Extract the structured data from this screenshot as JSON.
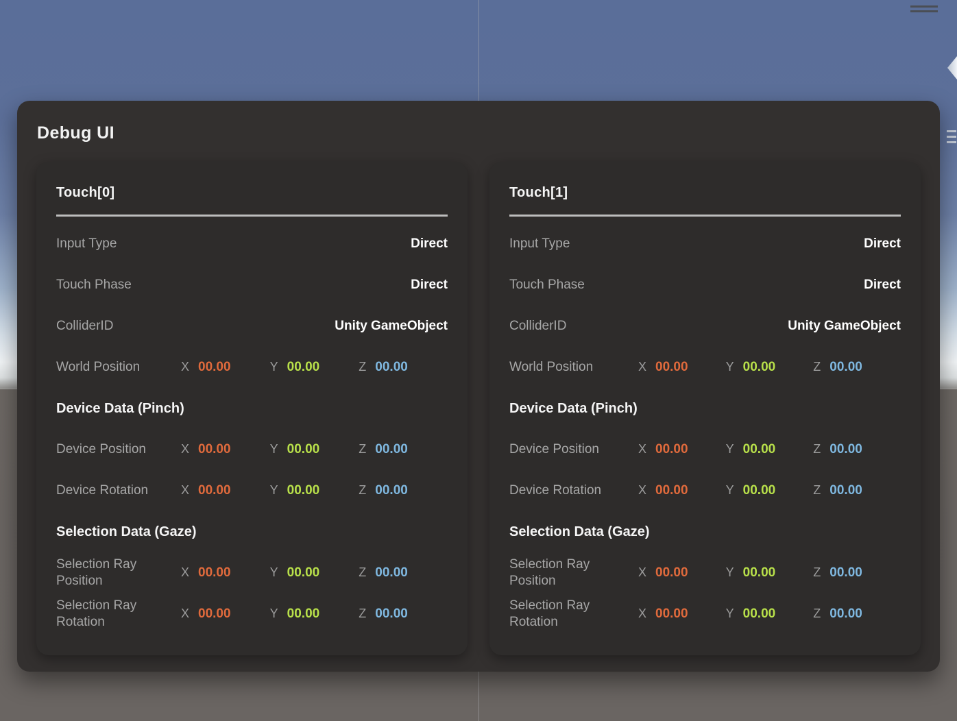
{
  "panel": {
    "title": "Debug UI"
  },
  "colors": {
    "axis_x": "#e06a3c",
    "axis_y": "#b8e04a",
    "axis_z": "#7fb8e0",
    "panel_bg": "#33302f",
    "card_bg": "#2e2c2b",
    "label": "#a7a7a7",
    "value": "#ffffff",
    "divider": "#bdbdbd",
    "gizmo_y": "#66e02a",
    "gizmo_x": "#c42a1c",
    "cube_fill": "#1a1a56",
    "cube_edge": "#3d4ed8"
  },
  "axis_tags": {
    "x": "X",
    "y": "Y",
    "z": "Z"
  },
  "cards": [
    {
      "title": "Touch[0]",
      "rows": [
        {
          "label": "Input Type",
          "value": "Direct"
        },
        {
          "label": "Touch Phase",
          "value": "Direct"
        },
        {
          "label": "ColliderID",
          "value": "Unity GameObject"
        }
      ],
      "world_position": {
        "label": "World Position",
        "x": "00.00",
        "y": "00.00",
        "z": "00.00"
      },
      "device_section": "Device Data (Pinch)",
      "device_position": {
        "label": "Device Position",
        "x": "00.00",
        "y": "00.00",
        "z": "00.00"
      },
      "device_rotation": {
        "label": "Device Rotation",
        "x": "00.00",
        "y": "00.00",
        "z": "00.00"
      },
      "selection_section": "Selection Data (Gaze)",
      "selection_ray_position": {
        "label": "Selection Ray Position",
        "x": "00.00",
        "y": "00.00",
        "z": "00.00"
      },
      "selection_ray_rotation": {
        "label": "Selection Ray Rotation",
        "x": "00.00",
        "y": "00.00",
        "z": "00.00"
      }
    },
    {
      "title": "Touch[1]",
      "rows": [
        {
          "label": "Input Type",
          "value": "Direct"
        },
        {
          "label": "Touch Phase",
          "value": "Direct"
        },
        {
          "label": "ColliderID",
          "value": "Unity GameObject"
        }
      ],
      "world_position": {
        "label": "World Position",
        "x": "00.00",
        "y": "00.00",
        "z": "00.00"
      },
      "device_section": "Device Data (Pinch)",
      "device_position": {
        "label": "Device Position",
        "x": "00.00",
        "y": "00.00",
        "z": "00.00"
      },
      "device_rotation": {
        "label": "Device Rotation",
        "x": "00.00",
        "y": "00.00",
        "z": "00.00"
      },
      "selection_section": "Selection Data (Gaze)",
      "selection_ray_position": {
        "label": "Selection Ray Position",
        "x": "00.00",
        "y": "00.00",
        "z": "00.00"
      },
      "selection_ray_rotation": {
        "label": "Selection Ray Rotation",
        "x": "00.00",
        "y": "00.00",
        "z": "00.00"
      }
    }
  ]
}
